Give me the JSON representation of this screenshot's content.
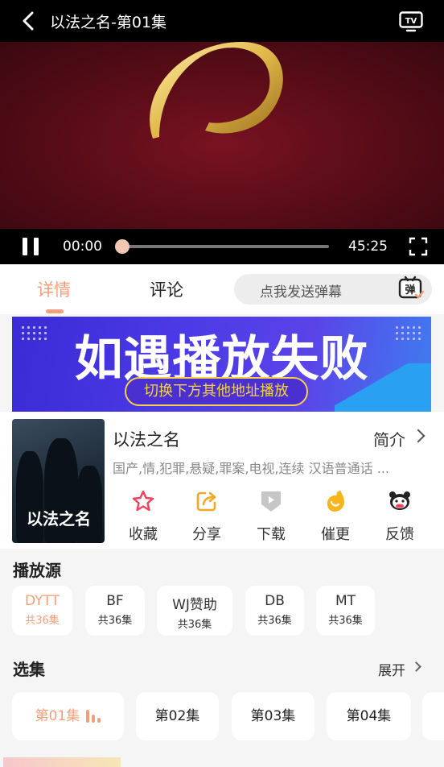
{
  "player": {
    "title": "以法之名-第01集",
    "current_time": "00:00",
    "duration": "45:25",
    "progress": 0
  },
  "tabs": {
    "detail": "详情",
    "comment": "评论",
    "danmu_placeholder": "点我发送弹幕",
    "danmu_icon_text": "弹"
  },
  "banner": {
    "headline": "如遇播放失败",
    "sub": "切换下方其他地址播放"
  },
  "show": {
    "title": "以法之名",
    "intro_label": "简介",
    "tags": "国产,情,犯罪,悬疑,罪案,电视,连续 汉语普通话 ...",
    "poster_text": "以法之名"
  },
  "actions": [
    {
      "label": "收藏",
      "icon": "star-icon"
    },
    {
      "label": "分享",
      "icon": "share-icon"
    },
    {
      "label": "下载",
      "icon": "download-icon"
    },
    {
      "label": "催更",
      "icon": "urge-icon"
    },
    {
      "label": "反馈",
      "icon": "feedback-icon"
    }
  ],
  "sources": {
    "heading": "播放源",
    "items": [
      {
        "name": "DYTT",
        "count": "共36集"
      },
      {
        "name": "BF",
        "count": "共36集"
      },
      {
        "name": "WJ赞助",
        "count": "共36集"
      },
      {
        "name": "DB",
        "count": "共36集"
      },
      {
        "name": "MT",
        "count": "共36集"
      }
    ]
  },
  "episodes": {
    "heading": "选集",
    "expand": "展开",
    "items": [
      "第01集",
      "第02集",
      "第03集",
      "第04集"
    ]
  },
  "colors": {
    "accent": "#f2a07b",
    "banner": "#4b3ae6",
    "gold": "#f7d14a"
  }
}
